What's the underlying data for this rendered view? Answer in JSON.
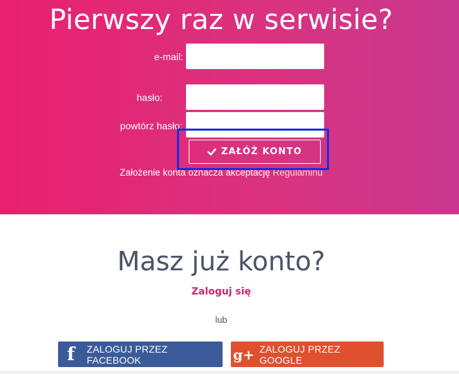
{
  "register": {
    "title": "Pierwszy raz w serwisie?",
    "email_label": "e-mail:",
    "password_label": "hasło:",
    "password_repeat_label": "powtórz hasło:",
    "email_value": "",
    "password_value": "",
    "password_repeat_value": "",
    "submit_label": "ZAŁÓŻ KONTO",
    "submit_icon": "check-icon",
    "terms_text": "Założenie konta oznacza akceptację ",
    "terms_link": "Regulaminu"
  },
  "login": {
    "title": "Masz już konto?",
    "login_link": "Zaloguj się",
    "or_text": "lub",
    "facebook_label": "ZALOGUJ PRZEZ FACEBOOK",
    "facebook_icon": "f",
    "google_label": "ZALOGUJ PRZEZ GOOGLE",
    "google_icon": "g+"
  },
  "colors": {
    "hero_gradient_start": "#e9206e",
    "hero_gradient_end": "#c9388e",
    "accent": "#d3256f",
    "facebook": "#3b5a9a",
    "google": "#e0502f",
    "highlight": "#1a2de0"
  }
}
